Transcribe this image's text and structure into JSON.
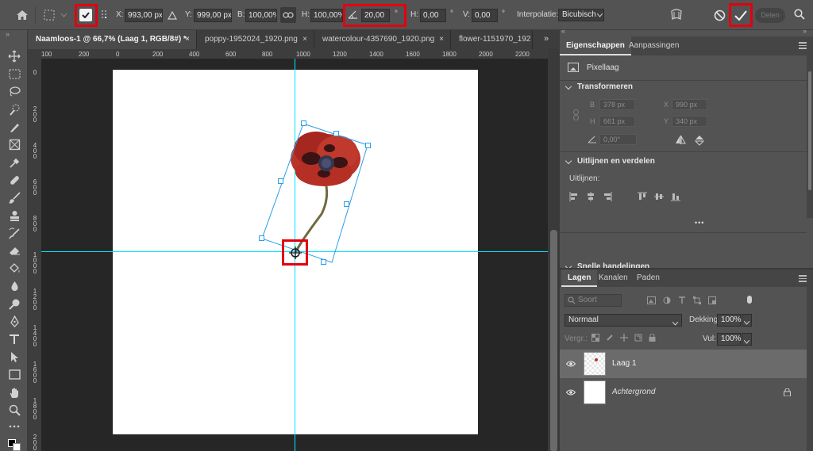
{
  "toolbar_top": {
    "home_icon": "home-icon",
    "x_label": "X:",
    "x_value": "993,00 px",
    "y_label": "Y:",
    "y_value": "999,00 px",
    "w_label": "B:",
    "w_value": "100,00%",
    "h_label": "H:",
    "h_value": "100,00%",
    "angle_value": "20,00",
    "angle_unit": "°",
    "hskew_label": "H:",
    "hskew_value": "0,00",
    "hskew_unit": "°",
    "vskew_label": "V:",
    "vskew_value": "0,00",
    "vskew_unit": "°",
    "interp_label": "Interpolatie:",
    "interp_value": "Bicubisch",
    "share_label": "Delen"
  },
  "tabs": [
    {
      "label": "Naamloos-1 @ 66,7% (Laag 1, RGB/8#) *",
      "close": "×"
    },
    {
      "label": "poppy-1952024_1920.png",
      "close": "×"
    },
    {
      "label": "watercolour-4357690_1920.png",
      "close": "×"
    },
    {
      "label": "flower-1151970_192",
      "close": ""
    }
  ],
  "tabs_more": "»",
  "ruler": {
    "h_ticks": [
      "100",
      "200",
      "0",
      "200",
      "400",
      "600",
      "800",
      "1000",
      "1200",
      "1400",
      "1600",
      "1800",
      "2000",
      "2200"
    ],
    "v_ticks": [
      "0",
      "200",
      "400",
      "600",
      "800",
      "1000",
      "1200",
      "1400",
      "1600",
      "1800",
      "2000"
    ]
  },
  "panel": {
    "tabs": [
      "Eigenschappen",
      "Aanpassingen"
    ],
    "layer_kind": "Pixellaag",
    "transform_title": "Transformeren",
    "b_label": "B",
    "b_value": "378 px",
    "x_label": "X",
    "x_value": "990 px",
    "h_label": "H",
    "h_value": "661 px",
    "y_label": "Y",
    "y_value": "340 px",
    "angle_value": "0,00°",
    "align_title": "Uitlijnen en verdelen",
    "align_sub": "Uitlijnen:",
    "more_dots": "•••",
    "quick_title": "Snelle handelingen"
  },
  "layers": {
    "tabs": [
      "Lagen",
      "Kanalen",
      "Paden"
    ],
    "search_placeholder": "Soort",
    "blend_mode": "Normaal",
    "opacity_label": "Dekking:",
    "opacity_value": "100%",
    "lock_label": "Vergr.:",
    "fill_label": "Vul:",
    "fill_value": "100%",
    "items": [
      {
        "name": "Laag 1"
      },
      {
        "name": "Achtergrond"
      }
    ]
  },
  "colors": {
    "highlight": "#e3000f",
    "guide": "#00e5ff",
    "transform_box": "#2b9fe8"
  }
}
